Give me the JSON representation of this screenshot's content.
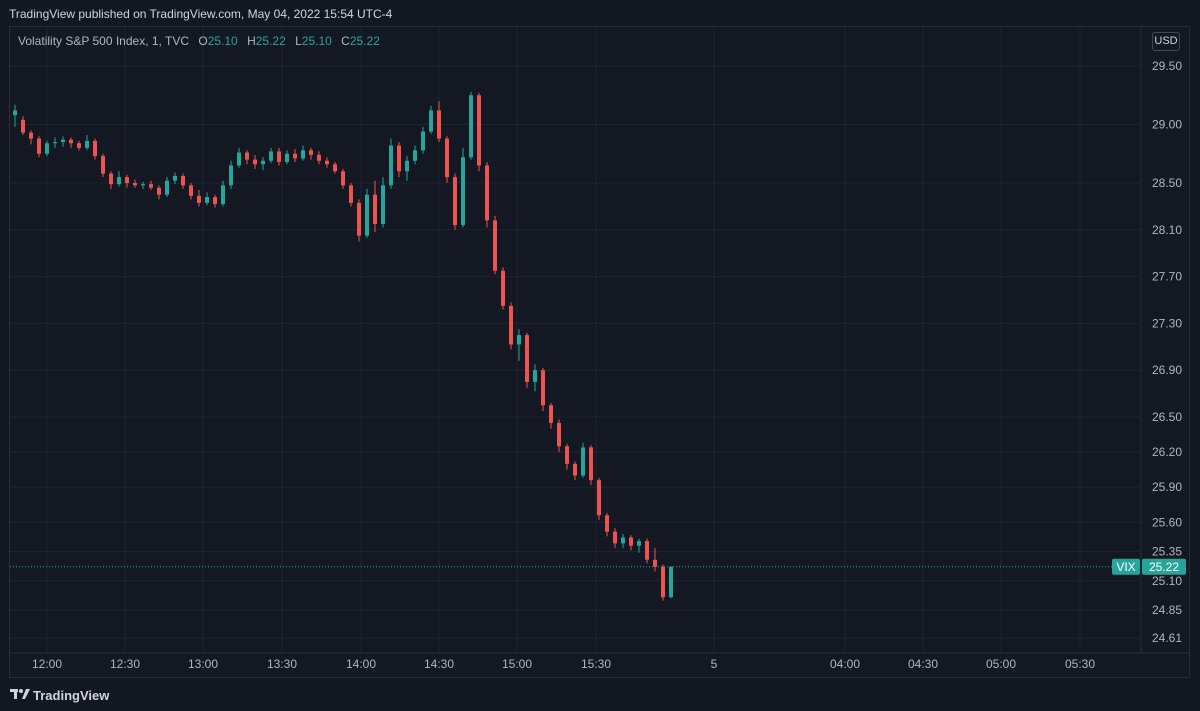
{
  "header": {
    "published": "TradingView published on TradingView.com, May 04, 2022 15:54 UTC-4"
  },
  "legend": {
    "symbol": "Volatility S&P 500 Index, 1, TVC",
    "o_label": "O",
    "o_value": "25.10",
    "h_label": "H",
    "h_value": "25.22",
    "l_label": "L",
    "l_value": "25.10",
    "c_label": "C",
    "c_value": "25.22"
  },
  "currency": "USD",
  "footer": {
    "brand": "TradingView"
  },
  "colors": {
    "up": "#26a69a",
    "down": "#ef5350",
    "background": "#131722",
    "grid": "#1f2433",
    "price_line": "#26a69a"
  },
  "chart_data": {
    "type": "candlestick",
    "title": "Volatility S&P 500 Index, 1, TVC",
    "price_tag": {
      "label": "VIX",
      "value": "25.22"
    },
    "y_ticks": [
      "29.50",
      "29.00",
      "28.50",
      "28.10",
      "27.70",
      "27.30",
      "26.90",
      "26.50",
      "26.20",
      "25.90",
      "25.60",
      "25.35",
      "25.10",
      "24.85",
      "24.61"
    ],
    "x_ticks": [
      "12:00",
      "12:30",
      "13:00",
      "13:30",
      "14:00",
      "14:30",
      "15:00",
      "15:30",
      "5",
      "04:00",
      "04:30",
      "05:00",
      "05:30"
    ],
    "series": [
      {
        "t": "11:48",
        "o": 29.08,
        "h": 29.17,
        "l": 28.98,
        "c": 29.12
      },
      {
        "t": "11:51",
        "o": 29.04,
        "h": 29.07,
        "l": 28.91,
        "c": 28.93
      },
      {
        "t": "11:54",
        "o": 28.93,
        "h": 28.95,
        "l": 28.83,
        "c": 28.88
      },
      {
        "t": "11:57",
        "o": 28.88,
        "h": 28.9,
        "l": 28.72,
        "c": 28.75
      },
      {
        "t": "12:00",
        "o": 28.75,
        "h": 28.86,
        "l": 28.73,
        "c": 28.84
      },
      {
        "t": "12:03",
        "o": 28.84,
        "h": 28.89,
        "l": 28.8,
        "c": 28.85
      },
      {
        "t": "12:06",
        "o": 28.85,
        "h": 28.9,
        "l": 28.81,
        "c": 28.87
      },
      {
        "t": "12:09",
        "o": 28.87,
        "h": 28.89,
        "l": 28.8,
        "c": 28.84
      },
      {
        "t": "12:12",
        "o": 28.84,
        "h": 28.86,
        "l": 28.78,
        "c": 28.8
      },
      {
        "t": "12:15",
        "o": 28.8,
        "h": 28.91,
        "l": 28.78,
        "c": 28.86
      },
      {
        "t": "12:18",
        "o": 28.86,
        "h": 28.88,
        "l": 28.7,
        "c": 28.73
      },
      {
        "t": "12:21",
        "o": 28.73,
        "h": 28.75,
        "l": 28.55,
        "c": 28.58
      },
      {
        "t": "12:24",
        "o": 28.58,
        "h": 28.6,
        "l": 28.45,
        "c": 28.49
      },
      {
        "t": "12:27",
        "o": 28.49,
        "h": 28.6,
        "l": 28.47,
        "c": 28.55
      },
      {
        "t": "12:30",
        "o": 28.55,
        "h": 28.57,
        "l": 28.46,
        "c": 28.5
      },
      {
        "t": "12:33",
        "o": 28.5,
        "h": 28.53,
        "l": 28.46,
        "c": 28.48
      },
      {
        "t": "12:36",
        "o": 28.48,
        "h": 28.51,
        "l": 28.45,
        "c": 28.49
      },
      {
        "t": "12:39",
        "o": 28.49,
        "h": 28.52,
        "l": 28.44,
        "c": 28.46
      },
      {
        "t": "12:42",
        "o": 28.46,
        "h": 28.48,
        "l": 28.36,
        "c": 28.4
      },
      {
        "t": "12:45",
        "o": 28.4,
        "h": 28.55,
        "l": 28.38,
        "c": 28.52
      },
      {
        "t": "12:48",
        "o": 28.52,
        "h": 28.59,
        "l": 28.49,
        "c": 28.56
      },
      {
        "t": "12:51",
        "o": 28.56,
        "h": 28.58,
        "l": 28.45,
        "c": 28.48
      },
      {
        "t": "12:54",
        "o": 28.48,
        "h": 28.5,
        "l": 28.36,
        "c": 28.39
      },
      {
        "t": "12:57",
        "o": 28.39,
        "h": 28.44,
        "l": 28.3,
        "c": 28.33
      },
      {
        "t": "13:00",
        "o": 28.33,
        "h": 28.42,
        "l": 28.31,
        "c": 28.38
      },
      {
        "t": "13:03",
        "o": 28.38,
        "h": 28.4,
        "l": 28.29,
        "c": 28.32
      },
      {
        "t": "13:06",
        "o": 28.32,
        "h": 28.52,
        "l": 28.3,
        "c": 28.48
      },
      {
        "t": "13:09",
        "o": 28.48,
        "h": 28.69,
        "l": 28.45,
        "c": 28.65
      },
      {
        "t": "13:12",
        "o": 28.65,
        "h": 28.8,
        "l": 28.63,
        "c": 28.76
      },
      {
        "t": "13:15",
        "o": 28.76,
        "h": 28.78,
        "l": 28.66,
        "c": 28.7
      },
      {
        "t": "13:18",
        "o": 28.7,
        "h": 28.74,
        "l": 28.62,
        "c": 28.66
      },
      {
        "t": "13:21",
        "o": 28.66,
        "h": 28.72,
        "l": 28.61,
        "c": 28.69
      },
      {
        "t": "13:24",
        "o": 28.69,
        "h": 28.8,
        "l": 28.67,
        "c": 28.77
      },
      {
        "t": "13:27",
        "o": 28.77,
        "h": 28.8,
        "l": 28.65,
        "c": 28.68
      },
      {
        "t": "13:30",
        "o": 28.68,
        "h": 28.78,
        "l": 28.66,
        "c": 28.75
      },
      {
        "t": "13:33",
        "o": 28.75,
        "h": 28.79,
        "l": 28.68,
        "c": 28.71
      },
      {
        "t": "13:36",
        "o": 28.71,
        "h": 28.82,
        "l": 28.69,
        "c": 28.78
      },
      {
        "t": "13:39",
        "o": 28.78,
        "h": 28.8,
        "l": 28.7,
        "c": 28.74
      },
      {
        "t": "13:42",
        "o": 28.74,
        "h": 28.77,
        "l": 28.66,
        "c": 28.69
      },
      {
        "t": "13:45",
        "o": 28.69,
        "h": 28.72,
        "l": 28.63,
        "c": 28.66
      },
      {
        "t": "13:48",
        "o": 28.66,
        "h": 28.68,
        "l": 28.58,
        "c": 28.6
      },
      {
        "t": "13:51",
        "o": 28.6,
        "h": 28.62,
        "l": 28.45,
        "c": 28.48
      },
      {
        "t": "13:54",
        "o": 28.48,
        "h": 28.5,
        "l": 28.3,
        "c": 28.33
      },
      {
        "t": "13:57",
        "o": 28.33,
        "h": 28.36,
        "l": 28.0,
        "c": 28.05
      },
      {
        "t": "14:00",
        "o": 28.05,
        "h": 28.45,
        "l": 28.03,
        "c": 28.4
      },
      {
        "t": "14:03",
        "o": 28.4,
        "h": 28.52,
        "l": 28.08,
        "c": 28.15
      },
      {
        "t": "14:06",
        "o": 28.15,
        "h": 28.55,
        "l": 28.12,
        "c": 28.48
      },
      {
        "t": "14:09",
        "o": 28.48,
        "h": 28.88,
        "l": 28.45,
        "c": 28.82
      },
      {
        "t": "14:12",
        "o": 28.82,
        "h": 28.85,
        "l": 28.55,
        "c": 28.6
      },
      {
        "t": "14:15",
        "o": 28.6,
        "h": 28.73,
        "l": 28.52,
        "c": 28.69
      },
      {
        "t": "14:18",
        "o": 28.69,
        "h": 28.82,
        "l": 28.66,
        "c": 28.78
      },
      {
        "t": "14:21",
        "o": 28.78,
        "h": 28.98,
        "l": 28.75,
        "c": 28.94
      },
      {
        "t": "14:24",
        "o": 28.94,
        "h": 29.16,
        "l": 28.92,
        "c": 29.12
      },
      {
        "t": "14:27",
        "o": 29.12,
        "h": 29.2,
        "l": 28.85,
        "c": 28.88
      },
      {
        "t": "14:30",
        "o": 28.88,
        "h": 28.9,
        "l": 28.5,
        "c": 28.55
      },
      {
        "t": "14:33",
        "o": 28.55,
        "h": 28.58,
        "l": 28.1,
        "c": 28.14
      },
      {
        "t": "14:36",
        "o": 28.14,
        "h": 28.8,
        "l": 28.12,
        "c": 28.72
      },
      {
        "t": "14:39",
        "o": 28.72,
        "h": 29.28,
        "l": 28.7,
        "c": 29.25
      },
      {
        "t": "14:42",
        "o": 29.25,
        "h": 29.27,
        "l": 28.6,
        "c": 28.65
      },
      {
        "t": "14:45",
        "o": 28.65,
        "h": 28.68,
        "l": 28.12,
        "c": 28.18
      },
      {
        "t": "14:48",
        "o": 28.18,
        "h": 28.22,
        "l": 27.72,
        "c": 27.75
      },
      {
        "t": "14:51",
        "o": 27.75,
        "h": 27.78,
        "l": 27.42,
        "c": 27.45
      },
      {
        "t": "14:54",
        "o": 27.45,
        "h": 27.48,
        "l": 27.08,
        "c": 27.12
      },
      {
        "t": "14:57",
        "o": 27.12,
        "h": 27.25,
        "l": 26.98,
        "c": 27.2
      },
      {
        "t": "15:00",
        "o": 27.2,
        "h": 27.22,
        "l": 26.75,
        "c": 26.8
      },
      {
        "t": "15:03",
        "o": 26.8,
        "h": 26.95,
        "l": 26.72,
        "c": 26.9
      },
      {
        "t": "15:06",
        "o": 26.9,
        "h": 26.92,
        "l": 26.55,
        "c": 26.6
      },
      {
        "t": "15:09",
        "o": 26.6,
        "h": 26.62,
        "l": 26.4,
        "c": 26.45
      },
      {
        "t": "15:12",
        "o": 26.45,
        "h": 26.48,
        "l": 26.2,
        "c": 26.25
      },
      {
        "t": "15:15",
        "o": 26.25,
        "h": 26.27,
        "l": 26.05,
        "c": 26.1
      },
      {
        "t": "15:18",
        "o": 26.1,
        "h": 26.12,
        "l": 25.96,
        "c": 26.0
      },
      {
        "t": "15:21",
        "o": 26.0,
        "h": 26.28,
        "l": 25.98,
        "c": 26.24
      },
      {
        "t": "15:24",
        "o": 26.24,
        "h": 26.26,
        "l": 25.92,
        "c": 25.96
      },
      {
        "t": "15:27",
        "o": 25.96,
        "h": 25.98,
        "l": 25.62,
        "c": 25.66
      },
      {
        "t": "15:30",
        "o": 25.66,
        "h": 25.68,
        "l": 25.48,
        "c": 25.52
      },
      {
        "t": "15:33",
        "o": 25.52,
        "h": 25.55,
        "l": 25.38,
        "c": 25.42
      },
      {
        "t": "15:36",
        "o": 25.42,
        "h": 25.5,
        "l": 25.38,
        "c": 25.47
      },
      {
        "t": "15:39",
        "o": 25.47,
        "h": 25.49,
        "l": 25.36,
        "c": 25.4
      },
      {
        "t": "15:42",
        "o": 25.4,
        "h": 25.46,
        "l": 25.34,
        "c": 25.44
      },
      {
        "t": "15:45",
        "o": 25.44,
        "h": 25.46,
        "l": 25.25,
        "c": 25.28
      },
      {
        "t": "15:48",
        "o": 25.28,
        "h": 25.38,
        "l": 25.18,
        "c": 25.22
      },
      {
        "t": "15:51",
        "o": 25.22,
        "h": 25.24,
        "l": 24.93,
        "c": 24.96
      },
      {
        "t": "15:54",
        "o": 24.96,
        "h": 25.22,
        "l": 24.95,
        "c": 25.22
      }
    ]
  }
}
